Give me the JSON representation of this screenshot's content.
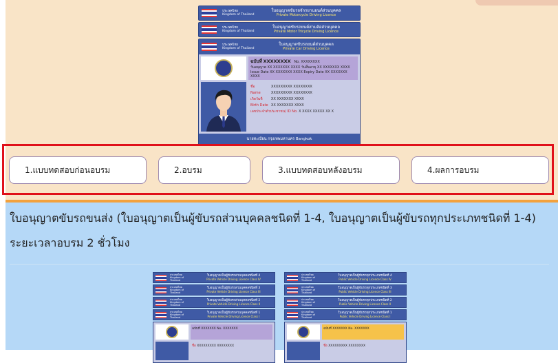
{
  "hero_card": {
    "country_th": "ประเทศไทย",
    "country_en": "Kingdom of Thailand",
    "strips": [
      {
        "th": "ใบอนุญาตขับรถจักรยานยนต์ส่วนบุคคล",
        "en": "Private Motorcycle Driving Licence"
      },
      {
        "th": "ใบอนุญาตขับรถยนต์สามล้อส่วนบุคคล",
        "en": "Private Motor Tricycle Driving Licence"
      },
      {
        "th": "ใบอนุญาตขับรถยนต์ส่วนบุคคล",
        "en": "Private Car Driving Licence"
      }
    ],
    "no_label": "ฉบับที่",
    "no_value": "XXXXXXXX",
    "no_en": "No.",
    "no_en_value": "XXXXXXXX",
    "issue_label": "วันอนุญาต",
    "issue_en": "Issue Date",
    "issue_value": "XX XXXXXXX XXXX",
    "expiry_label": "วันสิ้นอายุ",
    "expiry_en": "Expiry Date",
    "expiry_value": "XX XXXXXXX XXXX",
    "name_th_label": "ชื่อ",
    "name_th_value": "XXXXXXXXX XXXXXXXX",
    "name_en_label": "Name",
    "name_en_value": "XXXXXXXXX XXXXXXXX",
    "birth_th_label": "เกิดวันที่",
    "birth_th_value": "XX XXXXXXX XXXX",
    "birth_en_label": "Birth Date",
    "birth_en_value": "XX XXXXXXX XXXX",
    "id_label": "เลขประจำตัวประชาชน/ ID No.",
    "id_value": "X XXXX XXXXX XX X",
    "registrar": "นายทะเบียน กรุงเทพมหานคร Bangkok"
  },
  "tabs": [
    {
      "label": "1.แบบทดสอบก่อนอบรม"
    },
    {
      "label": "2.อบรม"
    },
    {
      "label": "3.แบบทดสอบหลังอบรม"
    },
    {
      "label": "4.ผลการอบรม"
    }
  ],
  "course": {
    "heading": "ใบอนุญาตขับรถขนส่ง (ใบอนุญาตเป็นผู้ขับรถส่วนบุคคลชนิดที่ 1-4, ใบอนุญาตเป็นผู้ขับรถทุกประเภทชนิดที่ 1-4)",
    "duration": "ระยะเวลาอบรม 2 ชั่วโมง"
  },
  "private_card": {
    "strips": [
      {
        "th": "ใบอนุญาตเป็นผู้ขับรถส่วนบุคคลชนิดที่ 4",
        "en": "Private Vehicle Driving Licence Class IV"
      },
      {
        "th": "ใบอนุญาตเป็นผู้ขับรถส่วนบุคคลชนิดที่ 3",
        "en": "Private Vehicle Driving Licence Class III"
      },
      {
        "th": "ใบอนุญาตเป็นผู้ขับรถส่วนบุคคลชนิดที่ 2",
        "en": "Private Vehicle Driving Licence Class II"
      },
      {
        "th": "ใบอนุญาตเป็นผู้ขับรถส่วนบุคคลชนิดที่ 1",
        "en": "Private Vehicle Driving Licence Class I"
      }
    ],
    "no_label": "ฉบับที่",
    "no_value": "XXXXXXX",
    "no_en": "No.",
    "no_en_value": "XXXXXXX",
    "name_label": "ชื่อ",
    "name_value": "XXXXXXXXX XXXXXXXX"
  },
  "public_card": {
    "strips": [
      {
        "th": "ใบอนุญาตเป็นผู้ขับรถทุกประเภทชนิดที่ 4",
        "en": "Public Vehicle Driving Licence Class IV"
      },
      {
        "th": "ใบอนุญาตเป็นผู้ขับรถทุกประเภทชนิดที่ 3",
        "en": "Public Vehicle Driving Licence Class III"
      },
      {
        "th": "ใบอนุญาตเป็นผู้ขับรถทุกประเภทชนิดที่ 2",
        "en": "Public Vehicle Driving Licence Class II"
      },
      {
        "th": "ใบอนุญาตเป็นผู้ขับรถทุกประเภทชนิดที่ 1",
        "en": "Public Vehicle Driving Licence Class I"
      }
    ],
    "no_label": "ฉบับที่",
    "no_value": "XXXXXXX",
    "no_en": "No.",
    "no_en_value": "XXXXXXX",
    "name_label": "ชื่อ",
    "name_value": "XXXXXXXXX XXXXXXXX"
  },
  "colors": {
    "top_bg": "#f9e4c7",
    "blue_bg": "#b5d8f7",
    "card_blue": "#3f5aa5",
    "highlight_red": "#e0101a",
    "divider_orange": "#f3a13c",
    "private_no_bg": "#b5a4d8",
    "public_no_bg": "#f6c24a"
  }
}
